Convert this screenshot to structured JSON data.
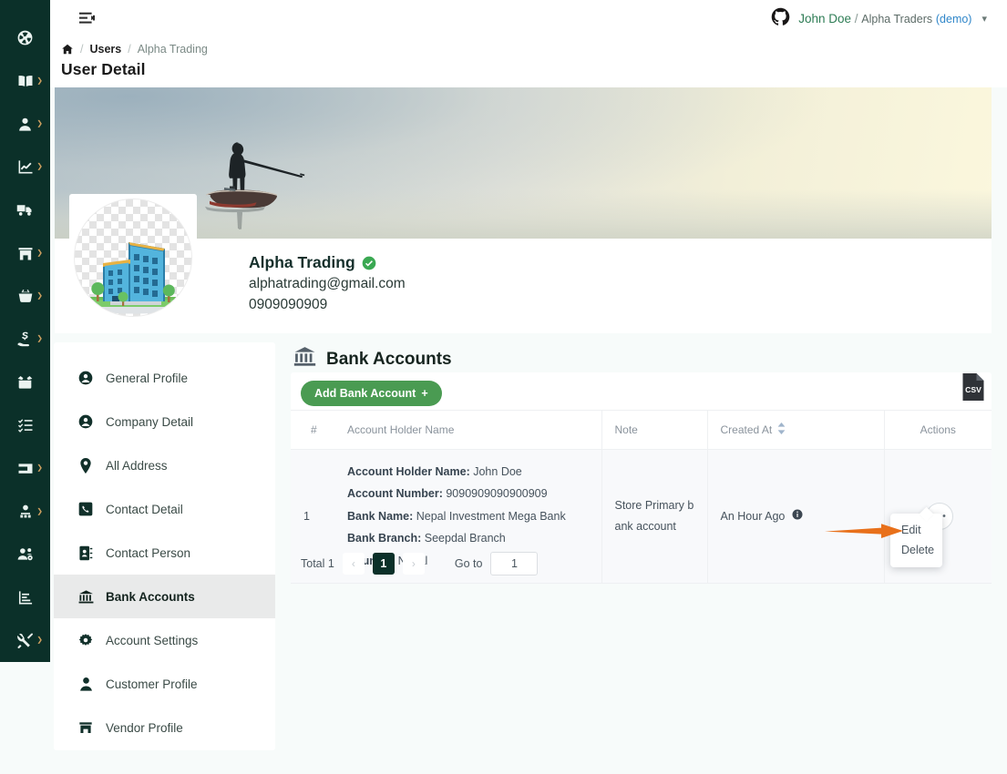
{
  "colors": {
    "sidebar_bg": "#0b3029",
    "accent_green": "#4a9b52",
    "link_blue": "#2f86c9",
    "annotation_orange": "#e8701a",
    "page_bg": "#f7fbfa"
  },
  "rail": {
    "items": [
      {
        "name": "dashboard",
        "icon": "dashboard-icon",
        "has_caret": false
      },
      {
        "name": "catalog",
        "icon": "open-book-icon",
        "has_caret": true
      },
      {
        "name": "users",
        "icon": "user-icon",
        "has_caret": true
      },
      {
        "name": "reports",
        "icon": "chart-line-icon",
        "has_caret": true
      },
      {
        "name": "delivery",
        "icon": "truck-icon",
        "has_caret": false
      },
      {
        "name": "store",
        "icon": "store-icon",
        "has_caret": true
      },
      {
        "name": "purchase",
        "icon": "basket-icon",
        "has_caret": true
      },
      {
        "name": "sales",
        "icon": "hand-money-icon",
        "has_caret": true
      },
      {
        "name": "inventory",
        "icon": "open-box-icon",
        "has_caret": false
      },
      {
        "name": "tasks",
        "icon": "checklist-icon",
        "has_caret": false
      },
      {
        "name": "wallet",
        "icon": "wallet-icon",
        "has_caret": true
      },
      {
        "name": "employees",
        "icon": "user-group-icon",
        "has_caret": true
      },
      {
        "name": "hr",
        "icon": "people-gear-icon",
        "has_caret": false
      },
      {
        "name": "analytics",
        "icon": "bar-chart-icon",
        "has_caret": false
      },
      {
        "name": "tools",
        "icon": "tools-icon",
        "has_caret": true
      }
    ]
  },
  "topbar": {
    "menu_fold_icon": "menu-fold-icon",
    "account_icon": "github-icon",
    "user_name": "John Doe",
    "separator": "/",
    "org_name": "Alpha Traders",
    "org_mode": "(demo)",
    "chevron": "⌄"
  },
  "breadcrumb": {
    "home_icon": "home-icon",
    "items": [
      "Users",
      "Alpha Trading"
    ],
    "slash": "/"
  },
  "page": {
    "title": "User Detail"
  },
  "profile": {
    "banner_alt": "lake-fisherman-banner-image",
    "avatar_alt": "office-building-avatar",
    "name": "Alpha Trading",
    "verified_icon": "verified-check-icon",
    "email": "alphatrading@gmail.com",
    "phone": "0909090909"
  },
  "side_menu": {
    "items": [
      {
        "label": "General Profile",
        "icon": "user-circle-icon",
        "active": false
      },
      {
        "label": "Company Detail",
        "icon": "user-circle-icon",
        "active": false
      },
      {
        "label": "All Address",
        "icon": "map-pin-icon",
        "active": false
      },
      {
        "label": "Contact Detail",
        "icon": "phone-square-icon",
        "active": false
      },
      {
        "label": "Contact Person",
        "icon": "address-book-icon",
        "active": false
      },
      {
        "label": "Bank Accounts",
        "icon": "bank-icon",
        "active": true
      },
      {
        "label": "Account Settings",
        "icon": "gear-icon",
        "active": false
      },
      {
        "label": "Customer Profile",
        "icon": "person-icon",
        "active": false
      },
      {
        "label": "Vendor Profile",
        "icon": "store-icon",
        "active": false
      }
    ]
  },
  "panel": {
    "title": "Bank Accounts",
    "title_icon": "bank-icon",
    "add_button": "Add Bank Account",
    "add_button_plus": "+",
    "export_icon": "csv-file-icon",
    "export_label": "CSV"
  },
  "table": {
    "columns": [
      "#",
      "Account Holder Name",
      "Note",
      "Created At",
      "Actions"
    ],
    "sort_icon": "sort-updown-icon",
    "rows": [
      {
        "index": "1",
        "details": [
          {
            "label": "Account Holder Name:",
            "value": "John Doe"
          },
          {
            "label": "Account Number:",
            "value": "9090909090900909"
          },
          {
            "label": "Bank Name:",
            "value": "Nepal Investment Mega Bank"
          },
          {
            "label": "Bank Branch:",
            "value": "Seepdal Branch"
          },
          {
            "label": "Country:",
            "value": "Nepal"
          }
        ],
        "note": "Store Primary bank account",
        "created_at": "An Hour Ago",
        "created_info_icon": "info-icon",
        "actions_icon": "ellipsis-icon"
      }
    ]
  },
  "pagination": {
    "total_label": "Total 1",
    "prev_icon": "‹",
    "current_page": "1",
    "next_icon": "›",
    "goto_label": "Go to",
    "goto_value": "1"
  },
  "dropdown": {
    "items": [
      "Edit",
      "Delete"
    ],
    "annotation_icon": "orange-arrow-annotation"
  }
}
